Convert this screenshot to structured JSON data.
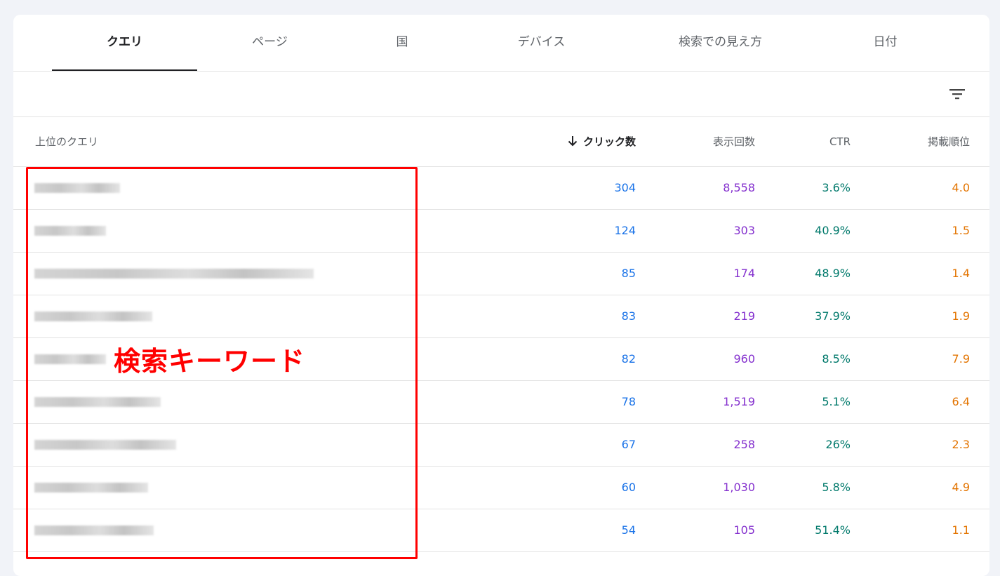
{
  "tabs": [
    "クエリ",
    "ページ",
    "国",
    "デバイス",
    "検索での見え方",
    "日付"
  ],
  "active_tab": "クエリ",
  "toolbar": {
    "filter_icon": "filter-list-icon"
  },
  "table": {
    "headers": {
      "query": "上位のクエリ",
      "clicks": "クリック数",
      "impressions": "表示回数",
      "ctr": "CTR",
      "position": "掲載順位"
    },
    "sort": {
      "column": "clicks",
      "direction": "desc",
      "icon": "arrow-down-icon"
    },
    "rows": [
      {
        "query": "",
        "clicks": "304",
        "impressions": "8,558",
        "ctr": "3.6%",
        "position": "4.0"
      },
      {
        "query": "",
        "clicks": "124",
        "impressions": "303",
        "ctr": "40.9%",
        "position": "1.5"
      },
      {
        "query": "",
        "clicks": "85",
        "impressions": "174",
        "ctr": "48.9%",
        "position": "1.4"
      },
      {
        "query": "",
        "clicks": "83",
        "impressions": "219",
        "ctr": "37.9%",
        "position": "1.9"
      },
      {
        "query": "",
        "clicks": "82",
        "impressions": "960",
        "ctr": "8.5%",
        "position": "7.9"
      },
      {
        "query": "",
        "clicks": "78",
        "impressions": "1,519",
        "ctr": "5.1%",
        "position": "6.4"
      },
      {
        "query": "",
        "clicks": "67",
        "impressions": "258",
        "ctr": "26%",
        "position": "2.3"
      },
      {
        "query": "",
        "clicks": "60",
        "impressions": "1,030",
        "ctr": "5.8%",
        "position": "4.9"
      },
      {
        "query": "",
        "clicks": "54",
        "impressions": "105",
        "ctr": "51.4%",
        "position": "1.1"
      }
    ]
  },
  "annotation": {
    "label": "検索キーワード",
    "color": "#ff0000"
  },
  "colors": {
    "clicks": "#1a73e8",
    "impressions": "#8430ce",
    "ctr": "#00796b",
    "position": "#e37400"
  }
}
